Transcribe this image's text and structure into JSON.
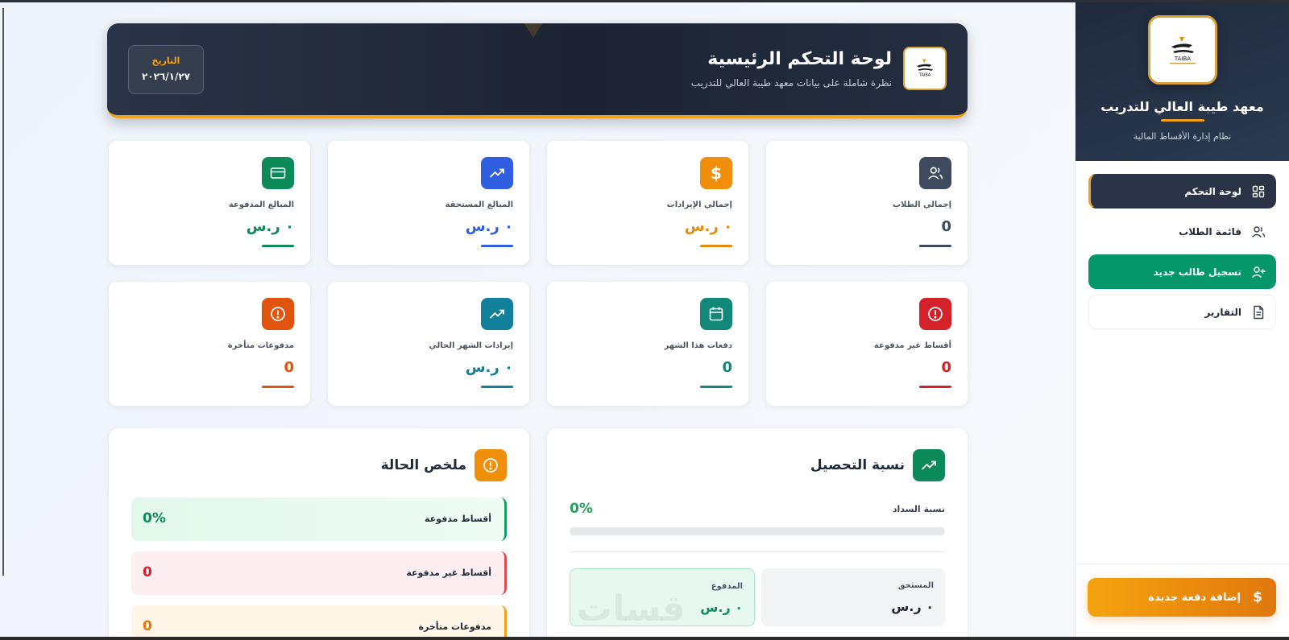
{
  "sidebar": {
    "institute_name": "معهد طيبة العالي للتدريب",
    "system_name": "نظام إدارة الأقساط المالية",
    "logo_text": "TAIBA",
    "nav": [
      {
        "label": "لوحة التحكم",
        "icon": "dashboard-icon",
        "active": true
      },
      {
        "label": "قائمة الطلاب",
        "icon": "users-icon"
      },
      {
        "label": "تسجيل طالب جديد",
        "icon": "user-plus-icon"
      },
      {
        "label": "التقارير",
        "icon": "document-icon"
      }
    ],
    "add_payment_label": "إضافة دفعة جديدة"
  },
  "header": {
    "title": "لوحة التحكم الرئيسية",
    "subtitle": "نظرة شاملة على بيانات معهد طيبة العالي للتدريب",
    "logo_text": "TAIBA",
    "date_label": "التاريخ",
    "date_value": "٢٠٢٦/١/٢٧"
  },
  "stats": [
    {
      "label": "إجمالي الطلاب",
      "value": "0",
      "color": "#3f4a5e",
      "icon": "users-icon"
    },
    {
      "label": "إجمالي الإيرادات",
      "value": "٠ ر.س",
      "color": "#e58a0c",
      "icon": "dollar-icon"
    },
    {
      "label": "المبالغ المستحقة",
      "value": "٠ ر.س",
      "color": "#2f5fe0",
      "icon": "trending-up-icon"
    },
    {
      "label": "المبالغ المدفوعة",
      "value": "٠ ر.س",
      "color": "#0c8a5a",
      "icon": "credit-card-icon"
    },
    {
      "label": "أقساط غير مدفوعة",
      "value": "0",
      "color": "#d4222a",
      "icon": "alert-circle-icon"
    },
    {
      "label": "دفعات هذا الشهر",
      "value": "0",
      "color": "#12877a",
      "icon": "calendar-icon"
    },
    {
      "label": "إيرادات الشهر الحالي",
      "value": "٠ ر.س",
      "color": "#12809a",
      "icon": "trending-up-icon"
    },
    {
      "label": "مدفوعات متأخرة",
      "value": "0",
      "color": "#e0540e",
      "icon": "alert-circle-icon"
    }
  ],
  "collection": {
    "title": "نسبة التحصيل",
    "rate_label": "نسبة السداد",
    "rate_value": "0%",
    "rate_fraction": 0,
    "due_label": "المستحق",
    "due_value": "٠ ر.س",
    "paid_label": "المدفوع",
    "paid_value": "٠ ر.س",
    "watermark": "قسات"
  },
  "status_summary": {
    "title": "ملخص الحالة",
    "rows": [
      {
        "label": "أقساط مدفوعة",
        "value": "0%"
      },
      {
        "label": "أقساط غير مدفوعة",
        "value": "0"
      },
      {
        "label": "مدفوعات متأخرة",
        "value": "0"
      }
    ]
  },
  "colors": {
    "accent_orange": "#f2a21a",
    "navy": "#1f2a3c",
    "green": "#059669"
  }
}
